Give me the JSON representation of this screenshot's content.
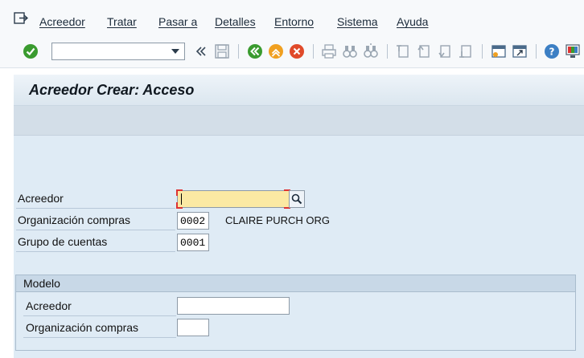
{
  "menu": {
    "items": [
      {
        "label": "Acreedor"
      },
      {
        "label": "Tratar"
      },
      {
        "label": "Pasar a"
      },
      {
        "label": "Detalles"
      },
      {
        "label": "Entorno"
      },
      {
        "label": "Sistema"
      },
      {
        "label": "Ayuda"
      }
    ]
  },
  "toolbar": {
    "command_field_value": "",
    "icons": [
      "enter-checkmark-icon",
      "back-double-arrow-icon",
      "save-icon",
      "back-green-icon",
      "exit-orange-icon",
      "cancel-red-icon",
      "print-icon",
      "find-icon",
      "find-next-icon",
      "first-page-icon",
      "prev-page-icon",
      "next-page-icon",
      "last-page-icon",
      "create-session-icon",
      "shortcut-icon",
      "help-icon",
      "layout-menu-icon"
    ]
  },
  "title": "Acreedor Crear: Acceso",
  "form": {
    "acreedor_label": "Acreedor",
    "acreedor_value": "",
    "org_compras_label": "Organización compras",
    "org_compras_value": "0002",
    "org_compras_desc": "CLAIRE PURCH ORG",
    "grupo_cuentas_label": "Grupo de cuentas",
    "grupo_cuentas_value": "0001"
  },
  "modelo": {
    "title": "Modelo",
    "acreedor_label": "Acreedor",
    "acreedor_value": "",
    "org_compras_label": "Organización compras",
    "org_compras_value": ""
  },
  "colors": {
    "required_field": "#fbe9a3",
    "work_area": "#dfebf5",
    "group_header": "#c8d8e7"
  }
}
